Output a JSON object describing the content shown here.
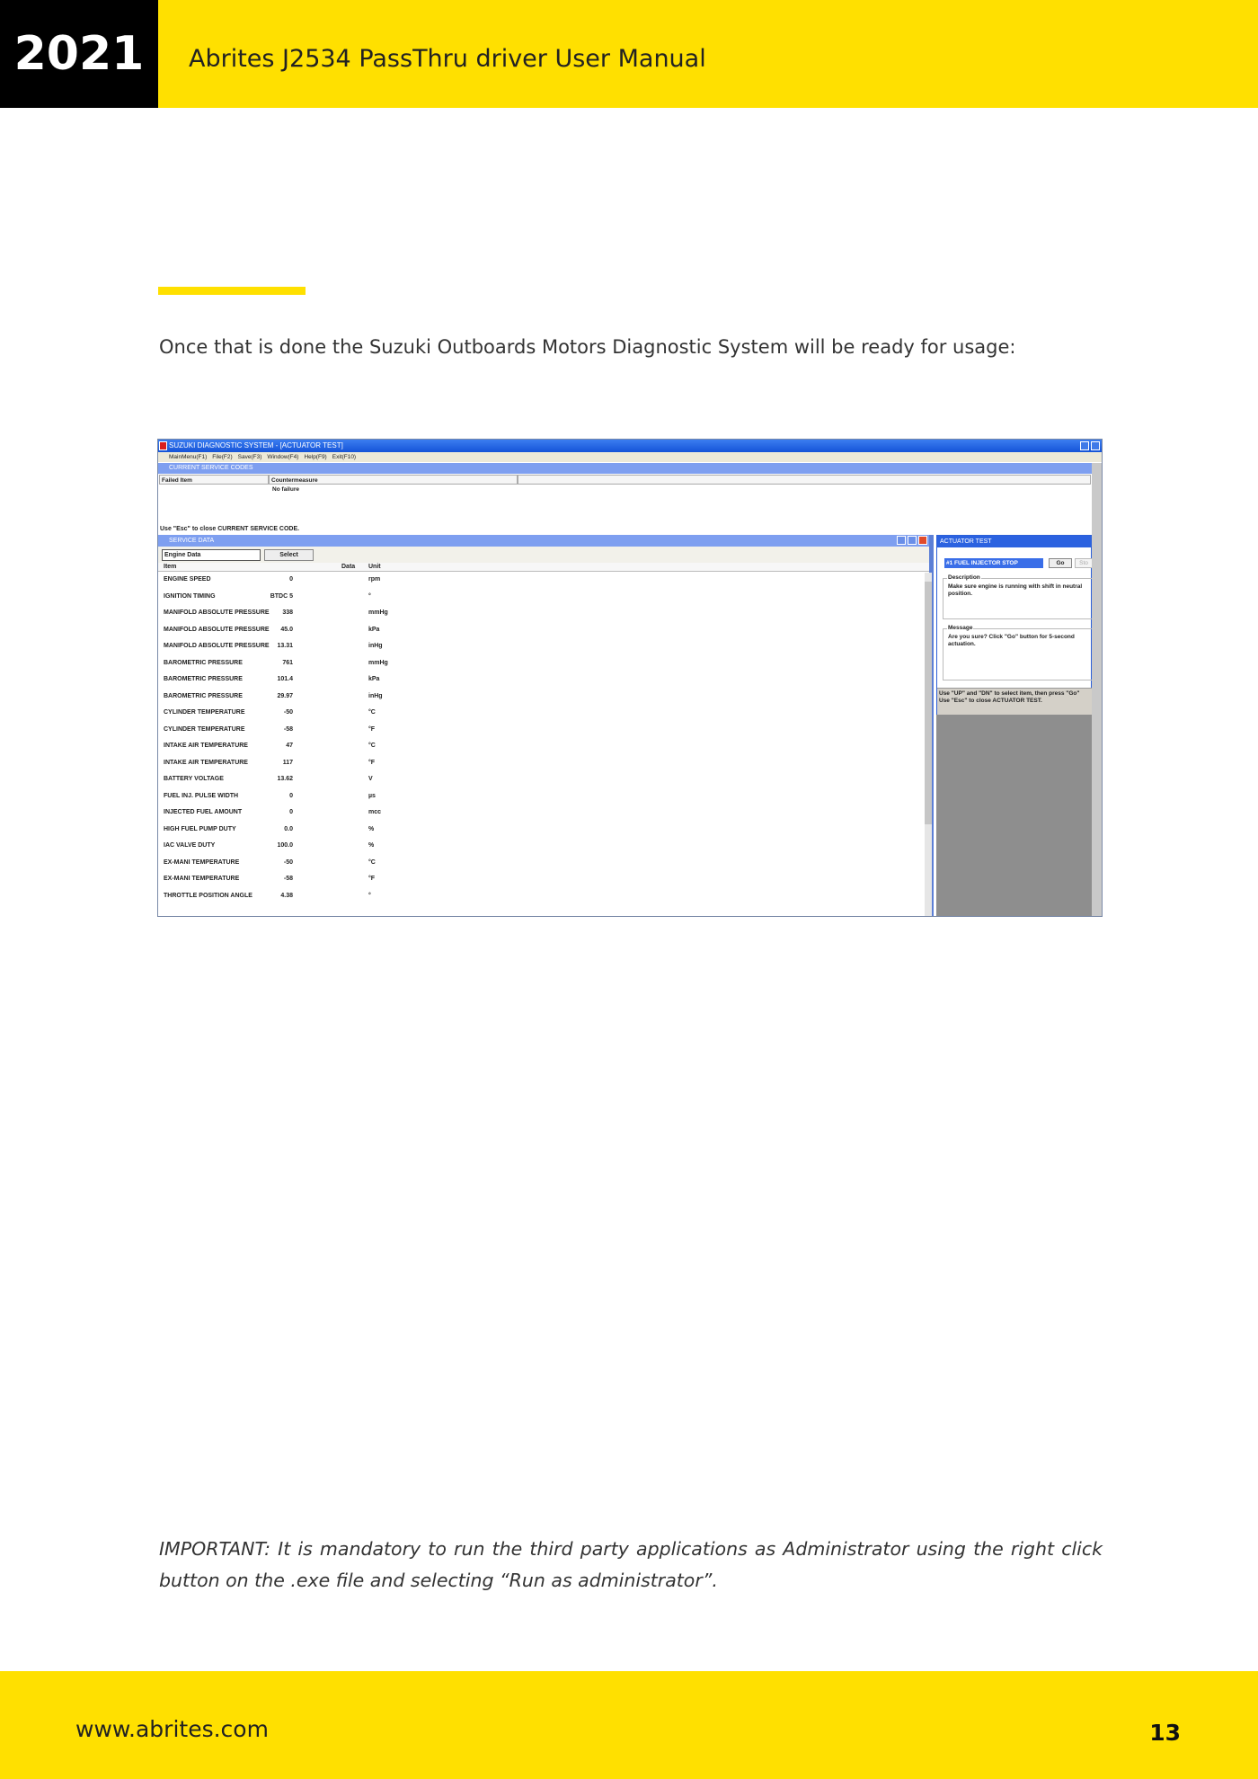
{
  "header": {
    "year": "2021",
    "title": "Abrites J2534 PassThru driver User Manual"
  },
  "intro_text": "Once that is done the Suzuki Outboards Motors Diagnostic System will be ready for usage:",
  "screenshot": {
    "window_title": "SUZUKI DIAGNOSTIC SYSTEM - [ACTUATOR TEST]",
    "menu": [
      "MainMenu(F1)",
      "File(F2)",
      "Save(F3)",
      "Window(F4)",
      "Help(F9)",
      "Exit(F10)"
    ],
    "current_service_codes": {
      "title": "CURRENT SERVICE CODES",
      "col_failed": "Failed Item",
      "col_counter": "Countermeasure",
      "value": "No failure",
      "footer": "Use \"Esc\" to close CURRENT SERVICE CODE."
    },
    "service_data": {
      "title": "SERVICE DATA",
      "select_value": "Engine Data",
      "select_button": "Select",
      "col_item": "Item",
      "col_data": "Data",
      "col_unit": "Unit",
      "rows": [
        {
          "item": "ENGINE SPEED",
          "data": "0",
          "unit": "rpm"
        },
        {
          "item": "IGNITION TIMING",
          "data": "BTDC 5",
          "unit": "°"
        },
        {
          "item": "MANIFOLD ABSOLUTE PRESSURE",
          "data": "338",
          "unit": "mmHg"
        },
        {
          "item": "MANIFOLD ABSOLUTE PRESSURE",
          "data": "45.0",
          "unit": "kPa"
        },
        {
          "item": "MANIFOLD ABSOLUTE PRESSURE",
          "data": "13.31",
          "unit": "inHg"
        },
        {
          "item": "BAROMETRIC PRESSURE",
          "data": "761",
          "unit": "mmHg"
        },
        {
          "item": "BAROMETRIC PRESSURE",
          "data": "101.4",
          "unit": "kPa"
        },
        {
          "item": "BAROMETRIC PRESSURE",
          "data": "29.97",
          "unit": "inHg"
        },
        {
          "item": "CYLINDER TEMPERATURE",
          "data": "-50",
          "unit": "°C"
        },
        {
          "item": "CYLINDER TEMPERATURE",
          "data": "-58",
          "unit": "°F"
        },
        {
          "item": "INTAKE AIR TEMPERATURE",
          "data": "47",
          "unit": "°C"
        },
        {
          "item": "INTAKE AIR TEMPERATURE",
          "data": "117",
          "unit": "°F"
        },
        {
          "item": "BATTERY VOLTAGE",
          "data": "13.62",
          "unit": "V"
        },
        {
          "item": "FUEL INJ. PULSE WIDTH",
          "data": "0",
          "unit": "µs"
        },
        {
          "item": "INJECTED FUEL AMOUNT",
          "data": "0",
          "unit": "mcc"
        },
        {
          "item": "HIGH FUEL PUMP DUTY",
          "data": "0.0",
          "unit": "%"
        },
        {
          "item": "IAC VALVE DUTY",
          "data": "100.0",
          "unit": "%"
        },
        {
          "item": "EX-MANI TEMPERATURE",
          "data": "-50",
          "unit": "°C"
        },
        {
          "item": "EX-MANI TEMPERATURE",
          "data": "-58",
          "unit": "°F"
        },
        {
          "item": "THROTTLE POSITION ANGLE",
          "data": "4.38",
          "unit": "°"
        }
      ]
    },
    "actuator_test": {
      "title": "ACTUATOR TEST",
      "select_value": "#1 FUEL INJECTOR STOP",
      "go_button": "Go",
      "stop_button": "Sto",
      "description_label": "Description",
      "description_text": "Make sure engine is running with shift in neutral position.",
      "message_label": "Message",
      "message_text": "Are you sure? Click \"Go\" button for 5-second actuation.",
      "footer_line1": "Use \"UP\" and \"DN\" to select item, then press \"Go\"",
      "footer_line2": "Use \"Esc\" to close ACTUATOR TEST."
    }
  },
  "important_text": "IMPORTANT: It is mandatory to run the third party applications as Administrator using the right click button on the .exe file and selecting “Run as administrator”.",
  "footer": {
    "url": "www.abrites.com",
    "page": "13"
  },
  "colors": {
    "brand_yellow": "#ffe000",
    "black": "#000000"
  }
}
